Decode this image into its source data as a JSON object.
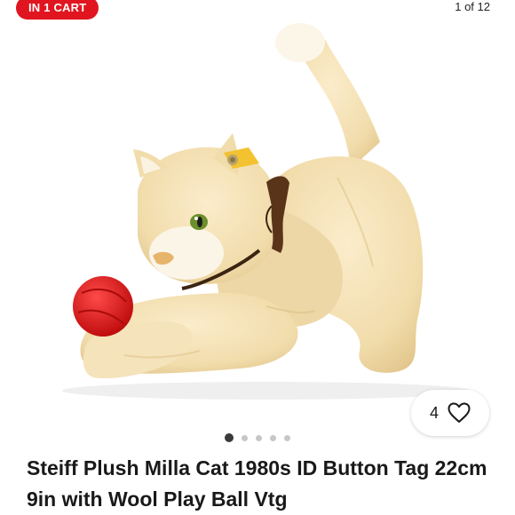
{
  "listing": {
    "cart_badge": "IN 1 CART",
    "image_counter": "1 of 12",
    "watch_count": "4",
    "title": "Steiff Plush Milla Cat 1980s ID Button Tag 22cm 9in with Wool Play Ball Vtg",
    "carousel": {
      "total_dots": 5,
      "active_index": 0
    }
  },
  "icons": {
    "heart": "heart-outline-icon"
  },
  "colors": {
    "badge_red": "#e0151f",
    "fur_cream": "#f3dfae",
    "ball_red": "#e01a1a",
    "ribbon_brown": "#5a3418",
    "tag_yellow": "#f2c230"
  }
}
